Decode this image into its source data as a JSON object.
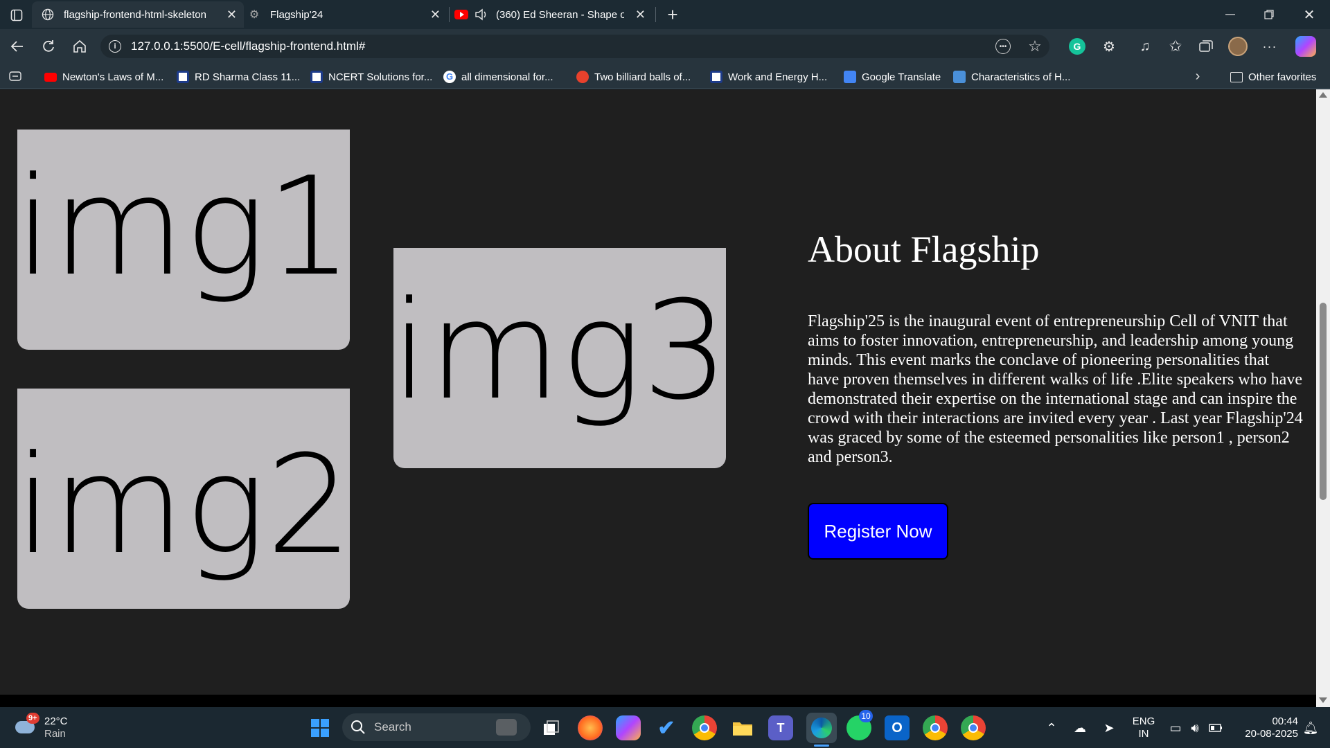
{
  "browser": {
    "tabs": [
      {
        "title": "flagship-frontend-html-skeleton",
        "active": true
      },
      {
        "title": "Flagship'24",
        "active": false
      },
      {
        "title": "(360) Ed Sheeran - Shape of",
        "active": false
      }
    ],
    "address": "127.0.0.1:5500/E-cell/flagship-frontend.html#",
    "bookmarks": [
      "Newton's Laws of M...",
      "RD Sharma Class 11...",
      "NCERT Solutions for...",
      "all dimensional for...",
      "Two billiard balls of...",
      "Work and Energy H...",
      "Google Translate",
      "Characteristics of H..."
    ],
    "other_favorites": "Other favorites"
  },
  "page": {
    "images": [
      "img1",
      "img2",
      "img3"
    ],
    "about_title": "About Flagship",
    "about_text": "Flagship'25 is the inaugural event of entrepreneurship Cell of VNIT that aims to foster innovation, entrepreneurship, and leadership among young minds. This event marks the conclave of pioneering personalities that have proven themselves in different walks of life .Elite speakers who have demonstrated their expertise on the international stage and can inspire the crowd with their interactions are invited every year . Last year Flagship'24 was graced by some of the esteemed personalities like person1 , person2 and person3.",
    "register_button": "Register Now",
    "button_color": "#0000ff",
    "background_color": "#1f1f1f"
  },
  "taskbar": {
    "weather_temp": "22°C",
    "weather_desc": "Rain",
    "weather_badge": "9+",
    "search_placeholder": "Search",
    "whatsapp_badge": "10",
    "language_line1": "ENG",
    "language_line2": "IN",
    "time": "00:44",
    "date": "20-08-2025"
  }
}
